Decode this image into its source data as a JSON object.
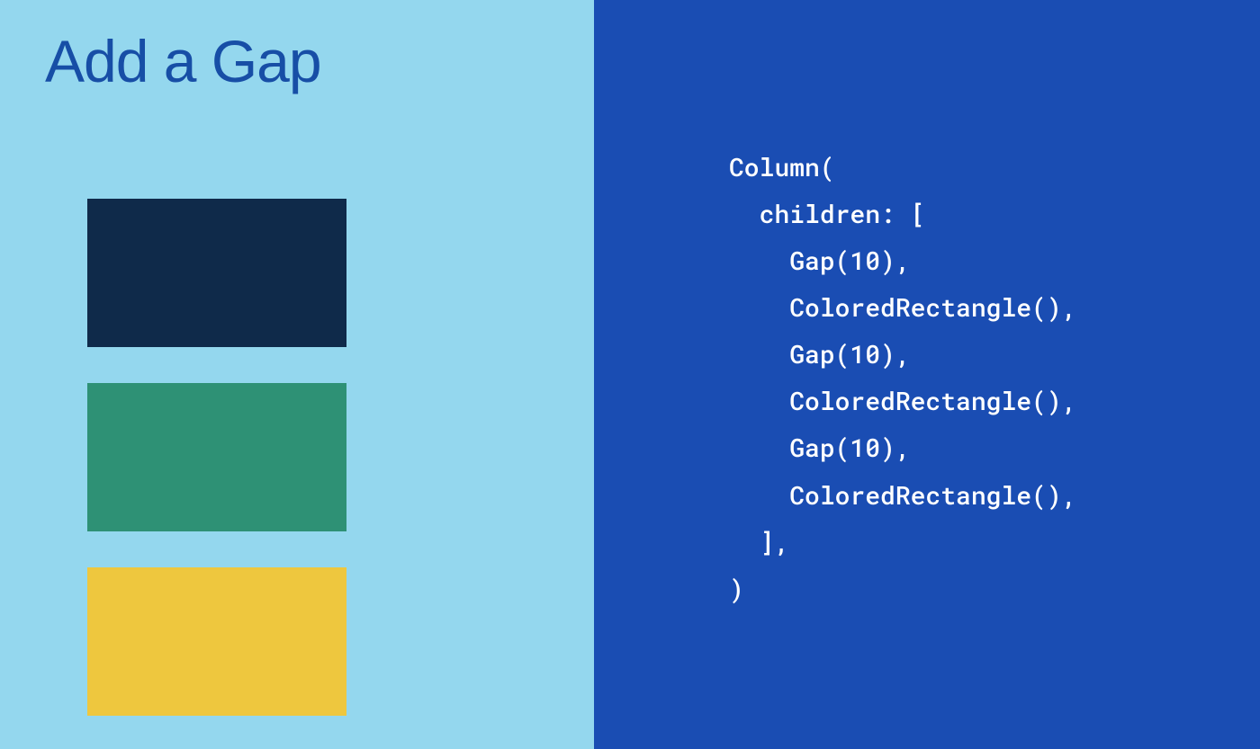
{
  "title": "Add a Gap",
  "rects": [
    {
      "color": "#0f2a4a"
    },
    {
      "color": "#2e9175"
    },
    {
      "color": "#eec73e"
    }
  ],
  "code": {
    "l1": "Column(",
    "l2": "  children: [",
    "l3": "    Gap(10),",
    "l4": "    ColoredRectangle(),",
    "l5": "    Gap(10),",
    "l6": "    ColoredRectangle(),",
    "l7": "    Gap(10),",
    "l8": "    ColoredRectangle(),",
    "l9": "  ],",
    "l10": ")"
  },
  "colors": {
    "leftBg": "#94d7ee",
    "rightBg": "#1a4db3",
    "titleColor": "#174ea6",
    "codeColor": "#ffffff"
  }
}
